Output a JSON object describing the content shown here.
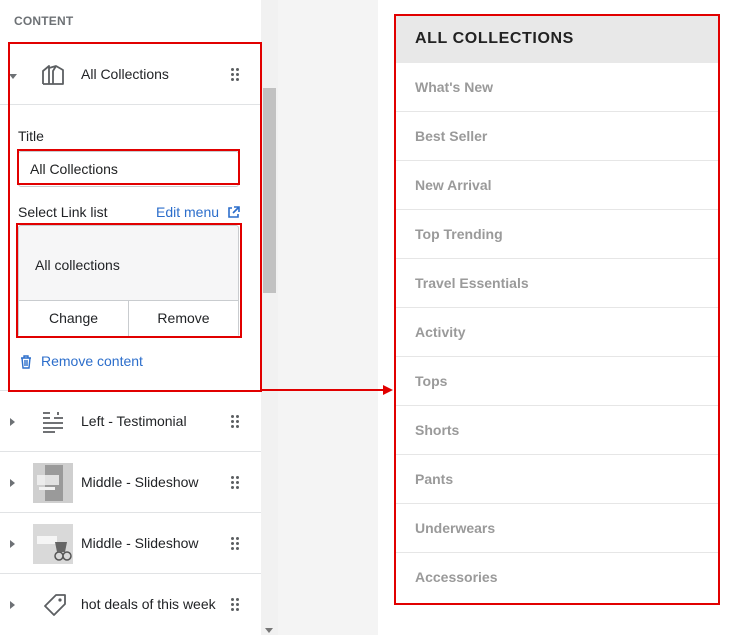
{
  "sidebar": {
    "section_label": "CONTENT",
    "expanded_block": {
      "title": "All Collections",
      "icon": "collections-icon",
      "title_label": "Title",
      "title_value": "All Collections",
      "link_list_label": "Select Link list",
      "edit_menu": "Edit menu",
      "link_list_value": "All collections",
      "change_label": "Change",
      "remove_label": "Remove",
      "remove_content": "Remove content"
    },
    "blocks": [
      {
        "label": "Left - Testimonial",
        "icon": "text-align-icon"
      },
      {
        "label": "Middle - Slideshow",
        "icon": "image-thumbnail"
      },
      {
        "label": "Middle - Slideshow",
        "icon": "image-thumbnail"
      },
      {
        "label": "hot deals of this week",
        "icon": "tag-icon"
      }
    ]
  },
  "preview_menu": {
    "heading": "ALL COLLECTIONS",
    "items": [
      "What's New",
      "Best Seller",
      "New Arrival",
      "Top Trending",
      "Travel Essentials",
      "Activity",
      "Tops",
      "Shorts",
      "Pants",
      "Underwears",
      "Accessories"
    ]
  },
  "colors": {
    "highlight": "#e10000",
    "link": "#2c6ecb",
    "menu_item_text": "#9a9a9a",
    "menu_header_bg": "#e8e8e8"
  }
}
